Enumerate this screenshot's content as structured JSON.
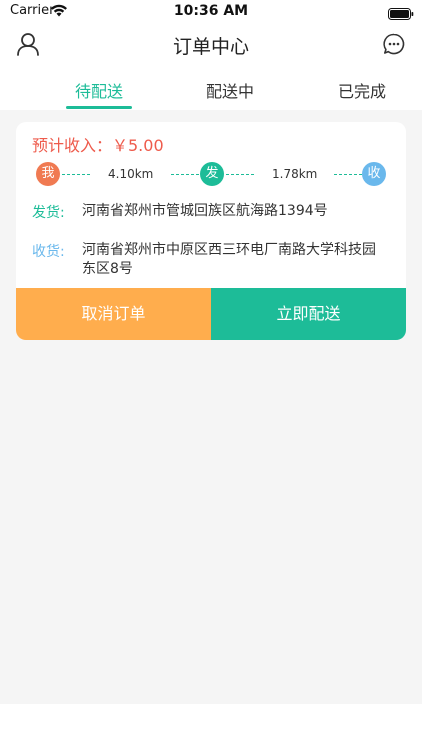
{
  "status_bar": {
    "carrier": "Carrier",
    "time": "10:36 AM"
  },
  "nav": {
    "title": "订单中心",
    "left_icon": "user-icon",
    "right_icon": "chat-icon"
  },
  "tabs": [
    {
      "label": "待配送",
      "active": true
    },
    {
      "label": "配送中",
      "active": false
    },
    {
      "label": "已完成",
      "active": false
    }
  ],
  "order": {
    "income": "预计收入：￥5.00",
    "route": {
      "me_label": "我",
      "pickup_label": "发",
      "dropoff_label": "收",
      "distance_to_pickup": "4.10km",
      "distance_to_dropoff": "1.78km"
    },
    "pickup": {
      "label": "发货:",
      "address": "河南省郑州市管城回族区航海路1394号"
    },
    "dropoff": {
      "label": "收货:",
      "address": "河南省郑州市中原区西三环电厂南路大学科技园东区8号"
    },
    "cancel_label": "取消订单",
    "deliver_label": "立即配送"
  },
  "colors": {
    "accent": "#1dbc98",
    "income": "#ee5b4c",
    "me_node": "#f07a52",
    "dropoff_node": "#6ab8ec",
    "cancel_button": "#ffad4d",
    "dropoff_label": "#6ab8ec"
  }
}
